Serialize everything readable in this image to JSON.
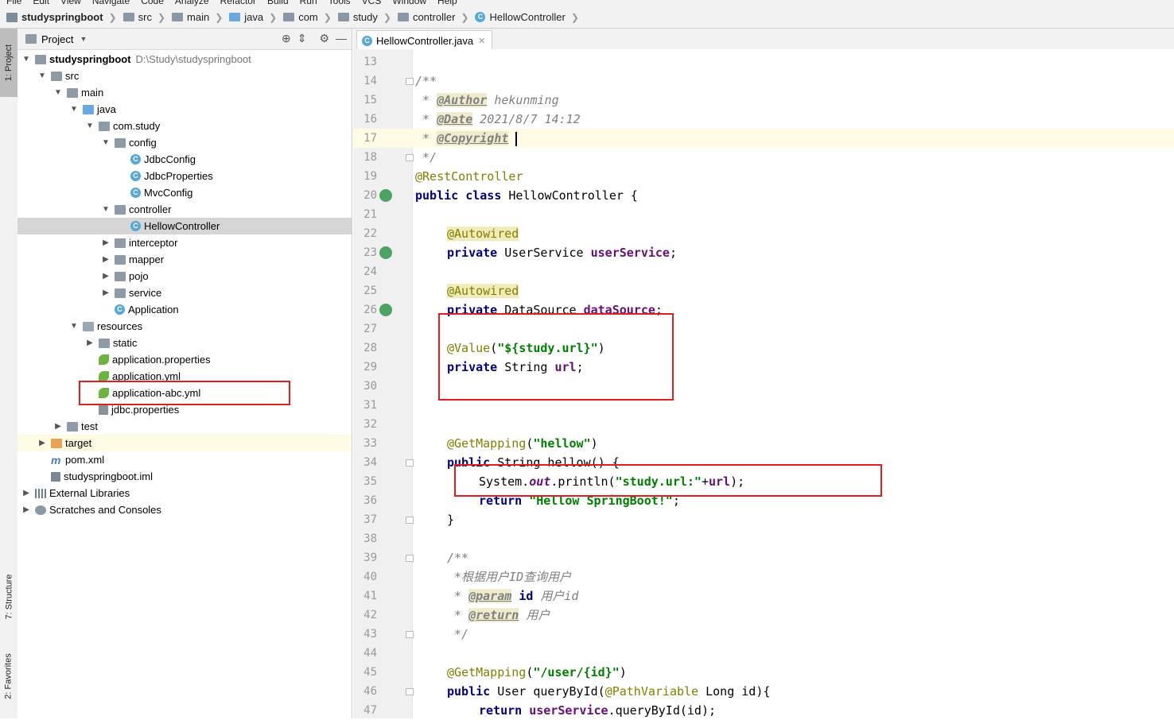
{
  "menubar": {
    "items": [
      "File",
      "Edit",
      "View",
      "Navigate",
      "Code",
      "Analyze",
      "Refactor",
      "Build",
      "Run",
      "Tools",
      "VCS",
      "Window",
      "Help"
    ]
  },
  "breadcrumb": {
    "items": [
      {
        "label": "studyspringboot",
        "icon": "project-icon"
      },
      {
        "label": "src",
        "icon": "folder-icon"
      },
      {
        "label": "main",
        "icon": "folder-icon"
      },
      {
        "label": "java",
        "icon": "source-folder-icon"
      },
      {
        "label": "com",
        "icon": "package-icon"
      },
      {
        "label": "study",
        "icon": "package-icon"
      },
      {
        "label": "controller",
        "icon": "package-icon"
      },
      {
        "label": "HellowController",
        "icon": "class-icon"
      }
    ]
  },
  "toolwindows": {
    "project": "1: Project",
    "structure": "7: Structure",
    "favorites": "2: Favorites"
  },
  "project_panel": {
    "title": "Project",
    "tree": [
      {
        "label": "studyspringboot",
        "path": "D:\\Study\\studyspringboot",
        "icon": "project-folder-icon",
        "depth": 0,
        "expanded": true,
        "bold": true
      },
      {
        "label": "src",
        "icon": "folder-icon",
        "depth": 1,
        "expanded": true
      },
      {
        "label": "main",
        "icon": "folder-icon",
        "depth": 2,
        "expanded": true
      },
      {
        "label": "java",
        "icon": "source-folder-icon",
        "depth": 3,
        "expanded": true
      },
      {
        "label": "com.study",
        "icon": "package-icon",
        "depth": 4,
        "expanded": true
      },
      {
        "label": "config",
        "icon": "package-icon",
        "depth": 5,
        "expanded": true
      },
      {
        "label": "JdbcConfig",
        "icon": "class-icon",
        "depth": 6
      },
      {
        "label": "JdbcProperties",
        "icon": "class-icon",
        "depth": 6
      },
      {
        "label": "MvcConfig",
        "icon": "class-icon",
        "depth": 6
      },
      {
        "label": "controller",
        "icon": "package-icon",
        "depth": 5,
        "expanded": true
      },
      {
        "label": "HellowController",
        "icon": "class-icon",
        "depth": 6,
        "selected": true
      },
      {
        "label": "interceptor",
        "icon": "package-icon",
        "depth": 5,
        "expanded": false
      },
      {
        "label": "mapper",
        "icon": "package-icon",
        "depth": 5,
        "expanded": false
      },
      {
        "label": "pojo",
        "icon": "package-icon",
        "depth": 5,
        "expanded": false
      },
      {
        "label": "service",
        "icon": "package-icon",
        "depth": 5,
        "expanded": false
      },
      {
        "label": "Application",
        "icon": "spring-boot-class-icon",
        "depth": 5
      },
      {
        "label": "resources",
        "icon": "resources-folder-icon",
        "depth": 3,
        "expanded": true
      },
      {
        "label": "static",
        "icon": "folder-icon",
        "depth": 4,
        "expanded": false
      },
      {
        "label": "application.properties",
        "icon": "spring-config-icon",
        "depth": 4
      },
      {
        "label": "application.yml",
        "icon": "spring-config-icon",
        "depth": 4
      },
      {
        "label": "application-abc.yml",
        "icon": "spring-config-icon",
        "depth": 4
      },
      {
        "label": "jdbc.properties",
        "icon": "properties-file-icon",
        "depth": 4
      },
      {
        "label": "test",
        "icon": "folder-icon",
        "depth": 2,
        "expanded": false
      },
      {
        "label": "target",
        "icon": "excluded-folder-icon",
        "depth": 1,
        "expanded": false,
        "highlight": true
      },
      {
        "label": "pom.xml",
        "icon": "maven-icon",
        "depth": 1
      },
      {
        "label": "studyspringboot.iml",
        "icon": "iml-file-icon",
        "depth": 1
      },
      {
        "label": "External Libraries",
        "icon": "library-icon",
        "depth": 0,
        "expanded": false
      },
      {
        "label": "Scratches and Consoles",
        "icon": "scratches-icon",
        "depth": 0,
        "expanded": false
      }
    ]
  },
  "editor": {
    "tab": {
      "label": "HellowController.java",
      "icon": "class-icon"
    },
    "current_line": 17,
    "line_numbers": [
      "13",
      "14",
      "15",
      "16",
      "17",
      "18",
      "19",
      "20",
      "21",
      "22",
      "23",
      "24",
      "25",
      "26",
      "27",
      "28",
      "29",
      "30",
      "31",
      "32",
      "33",
      "34",
      "35",
      "36",
      "37",
      "38",
      "39",
      "40",
      "41",
      "42",
      "43",
      "44",
      "45",
      "46",
      "47"
    ],
    "code": [
      {
        "ln": "13",
        "indent": 0,
        "tokens": []
      },
      {
        "ln": "14",
        "indent": 0,
        "tokens": [
          {
            "t": "/**",
            "c": "cmt"
          }
        ]
      },
      {
        "ln": "15",
        "indent": 0,
        "tokens": [
          {
            "t": " * ",
            "c": "cmt"
          },
          {
            "t": "@Author",
            "c": "doctag"
          },
          {
            "t": " hekunming",
            "c": "cmt"
          }
        ]
      },
      {
        "ln": "16",
        "indent": 0,
        "tokens": [
          {
            "t": " * ",
            "c": "cmt"
          },
          {
            "t": "@Date",
            "c": "doctag"
          },
          {
            "t": " 2021/8/7 14:12",
            "c": "cmt"
          }
        ]
      },
      {
        "ln": "17",
        "indent": 0,
        "tokens": [
          {
            "t": " * ",
            "c": "cmt"
          },
          {
            "t": "@Copyright",
            "c": "doctag"
          },
          {
            "t": " ",
            "c": "cmt"
          },
          {
            "t": "",
            "c": "caret"
          }
        ]
      },
      {
        "ln": "18",
        "indent": 0,
        "tokens": [
          {
            "t": " */",
            "c": "cmt"
          }
        ]
      },
      {
        "ln": "19",
        "indent": 0,
        "tokens": [
          {
            "t": "@RestController",
            "c": "ann"
          }
        ]
      },
      {
        "ln": "20",
        "indent": 0,
        "tokens": [
          {
            "t": "public class ",
            "c": "kw"
          },
          {
            "t": "HellowController {",
            "c": ""
          }
        ]
      },
      {
        "ln": "21",
        "indent": 0,
        "tokens": []
      },
      {
        "ln": "22",
        "indent": 1,
        "tokens": [
          {
            "t": "@Autowired",
            "c": "annbg"
          }
        ]
      },
      {
        "ln": "23",
        "indent": 1,
        "tokens": [
          {
            "t": "private ",
            "c": "kw"
          },
          {
            "t": "UserService ",
            "c": ""
          },
          {
            "t": "userService",
            "c": "fld"
          },
          {
            "t": ";",
            "c": ""
          }
        ]
      },
      {
        "ln": "24",
        "indent": 0,
        "tokens": []
      },
      {
        "ln": "25",
        "indent": 1,
        "tokens": [
          {
            "t": "@Autowired",
            "c": "annbg"
          }
        ]
      },
      {
        "ln": "26",
        "indent": 1,
        "tokens": [
          {
            "t": "private ",
            "c": "kw"
          },
          {
            "t": "DataSource ",
            "c": ""
          },
          {
            "t": "dataSource",
            "c": "fld"
          },
          {
            "t": ";",
            "c": ""
          }
        ]
      },
      {
        "ln": "27",
        "indent": 0,
        "tokens": []
      },
      {
        "ln": "28",
        "indent": 1,
        "tokens": [
          {
            "t": "@Value",
            "c": "ann"
          },
          {
            "t": "(",
            "c": ""
          },
          {
            "t": "\"${study.url}\"",
            "c": "str"
          },
          {
            "t": ")",
            "c": ""
          }
        ]
      },
      {
        "ln": "29",
        "indent": 1,
        "tokens": [
          {
            "t": "private ",
            "c": "kw"
          },
          {
            "t": "String ",
            "c": ""
          },
          {
            "t": "url",
            "c": "fld"
          },
          {
            "t": ";",
            "c": ""
          }
        ]
      },
      {
        "ln": "30",
        "indent": 0,
        "tokens": []
      },
      {
        "ln": "31",
        "indent": 0,
        "tokens": []
      },
      {
        "ln": "32",
        "indent": 0,
        "tokens": []
      },
      {
        "ln": "33",
        "indent": 1,
        "tokens": [
          {
            "t": "@GetMapping",
            "c": "ann"
          },
          {
            "t": "(",
            "c": ""
          },
          {
            "t": "\"hellow\"",
            "c": "str"
          },
          {
            "t": ")",
            "c": ""
          }
        ]
      },
      {
        "ln": "34",
        "indent": 1,
        "tokens": [
          {
            "t": "public ",
            "c": "kw"
          },
          {
            "t": "String hellow() {",
            "c": ""
          }
        ]
      },
      {
        "ln": "35",
        "indent": 2,
        "tokens": [
          {
            "t": "System.",
            "c": ""
          },
          {
            "t": "out",
            "c": "fldi"
          },
          {
            "t": ".println(",
            "c": ""
          },
          {
            "t": "\"study.url:\"",
            "c": "str"
          },
          {
            "t": "+",
            "c": ""
          },
          {
            "t": "url",
            "c": "fld"
          },
          {
            "t": ");",
            "c": ""
          }
        ]
      },
      {
        "ln": "36",
        "indent": 2,
        "tokens": [
          {
            "t": "return ",
            "c": "kw"
          },
          {
            "t": "\"Hellow SpringBoot!\"",
            "c": "str"
          },
          {
            "t": ";",
            "c": ""
          }
        ]
      },
      {
        "ln": "37",
        "indent": 1,
        "tokens": [
          {
            "t": "}",
            "c": ""
          }
        ]
      },
      {
        "ln": "38",
        "indent": 0,
        "tokens": []
      },
      {
        "ln": "39",
        "indent": 1,
        "tokens": [
          {
            "t": "/**",
            "c": "cmt"
          }
        ]
      },
      {
        "ln": "40",
        "indent": 1,
        "tokens": [
          {
            "t": " *根据用户ID查询用户",
            "c": "cmt"
          }
        ]
      },
      {
        "ln": "41",
        "indent": 1,
        "tokens": [
          {
            "t": " * ",
            "c": "cmt"
          },
          {
            "t": "@param",
            "c": "doctag"
          },
          {
            "t": " ",
            "c": "cmt"
          },
          {
            "t": "id",
            "c": "kw"
          },
          {
            "t": " 用户id",
            "c": "cmt"
          }
        ]
      },
      {
        "ln": "42",
        "indent": 1,
        "tokens": [
          {
            "t": " * ",
            "c": "cmt"
          },
          {
            "t": "@return",
            "c": "doctag"
          },
          {
            "t": " 用户",
            "c": "cmt"
          }
        ]
      },
      {
        "ln": "43",
        "indent": 1,
        "tokens": [
          {
            "t": " */",
            "c": "cmt"
          }
        ]
      },
      {
        "ln": "44",
        "indent": 0,
        "tokens": []
      },
      {
        "ln": "45",
        "indent": 1,
        "tokens": [
          {
            "t": "@GetMapping",
            "c": "ann"
          },
          {
            "t": "(",
            "c": ""
          },
          {
            "t": "\"/user/{id}\"",
            "c": "str"
          },
          {
            "t": ")",
            "c": ""
          }
        ]
      },
      {
        "ln": "46",
        "indent": 1,
        "tokens": [
          {
            "t": "public ",
            "c": "kw"
          },
          {
            "t": "User queryById(",
            "c": ""
          },
          {
            "t": "@PathVariable",
            "c": "ann"
          },
          {
            "t": " Long id){",
            "c": ""
          }
        ]
      },
      {
        "ln": "47",
        "indent": 2,
        "tokens": [
          {
            "t": "return ",
            "c": "kw"
          },
          {
            "t": "userService",
            "c": "fld"
          },
          {
            "t": ".queryById(id);",
            "c": ""
          }
        ]
      }
    ]
  },
  "colors": {
    "highlight_box": "#e02020",
    "spring_green": "#6db33f",
    "current_line": "#fdfbe3"
  }
}
